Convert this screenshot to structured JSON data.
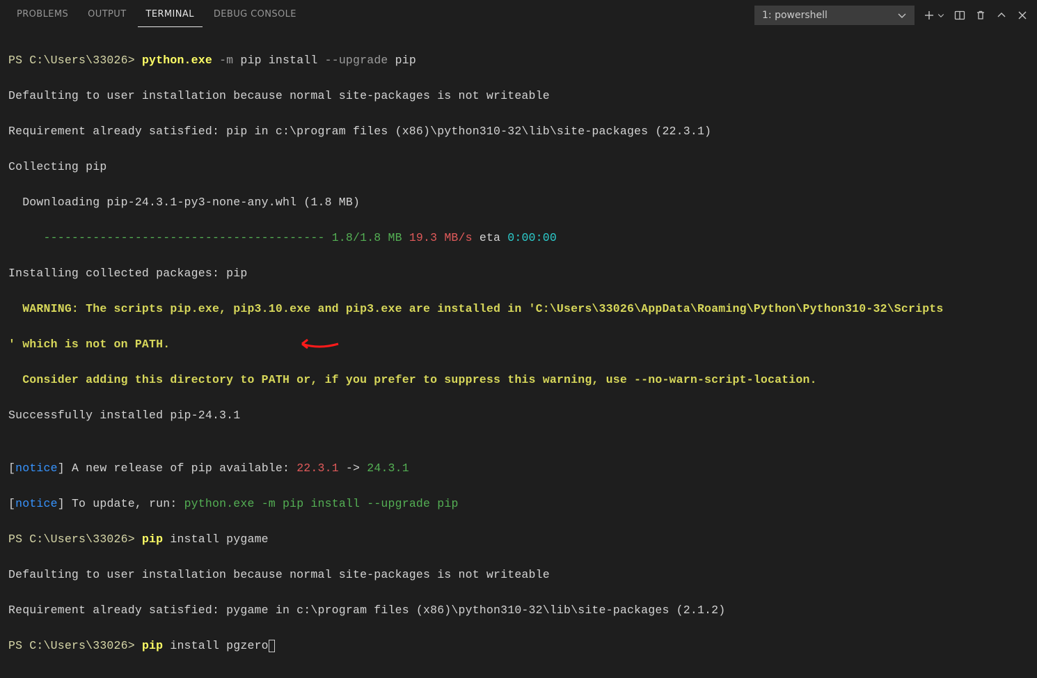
{
  "tabs": {
    "problems": "PROBLEMS",
    "output": "OUTPUT",
    "terminal": "TERMINAL",
    "debug_console": "DEBUG CONSOLE"
  },
  "shell_select": {
    "label": "1: powershell"
  },
  "term": {
    "l1_prompt": "PS C:\\Users\\33026> ",
    "l1_cmd": "python.exe",
    "l1_flag": " -m",
    "l1_rest": " pip install ",
    "l1_flag2": "--upgrade",
    "l1_rest2": " pip",
    "l2": "Defaulting to user installation because normal site-packages is not writeable",
    "l3": "Requirement already satisfied: pip in c:\\program files (x86)\\python310-32\\lib\\site-packages (22.3.1)",
    "l4": "Collecting pip",
    "l5": "  Downloading pip-24.3.1-py3-none-any.whl (1.8 MB)",
    "l6_pad": "     ",
    "l6_dashes": "---------------------------------------- ",
    "l6_size": "1.8/1.8 MB ",
    "l6_speed": "19.3 MB/s",
    "l6_eta_lbl": " eta ",
    "l6_eta": "0:00:00",
    "l7": "Installing collected packages: pip",
    "l8a": "  WARNING: The scripts pip.exe, pip3.10.exe and pip3.exe are installed in 'C:\\Users\\33026\\AppData\\Roaming\\Python\\Python310-32\\Scripts",
    "l8b": "' which is not on PATH.",
    "l9": "  Consider adding this directory to PATH or, if you prefer to suppress this warning, use --no-warn-script-location.",
    "l10": "Successfully installed pip-24.3.1",
    "l11": "",
    "l12_br": "[",
    "l12_n": "notice",
    "l12_br2": "]",
    "l12_t": " A new release of pip available: ",
    "l12_v1": "22.3.1",
    "l12_arrow": " -> ",
    "l12_v2": "24.3.1",
    "l13_br": "[",
    "l13_n": "notice",
    "l13_br2": "]",
    "l13_t": " To update, run: ",
    "l13_cmd": "python.exe -m pip install --upgrade pip",
    "l14_prompt": "PS C:\\Users\\33026> ",
    "l14_cmd": "pip",
    "l14_rest": " install pygame",
    "l15": "Defaulting to user installation because normal site-packages is not writeable",
    "l16": "Requirement already satisfied: pygame in c:\\program files (x86)\\python310-32\\lib\\site-packages (2.1.2)",
    "l17_prompt": "PS C:\\Users\\33026> ",
    "l17_cmd": "pip",
    "l17_rest": " install pgzero"
  }
}
